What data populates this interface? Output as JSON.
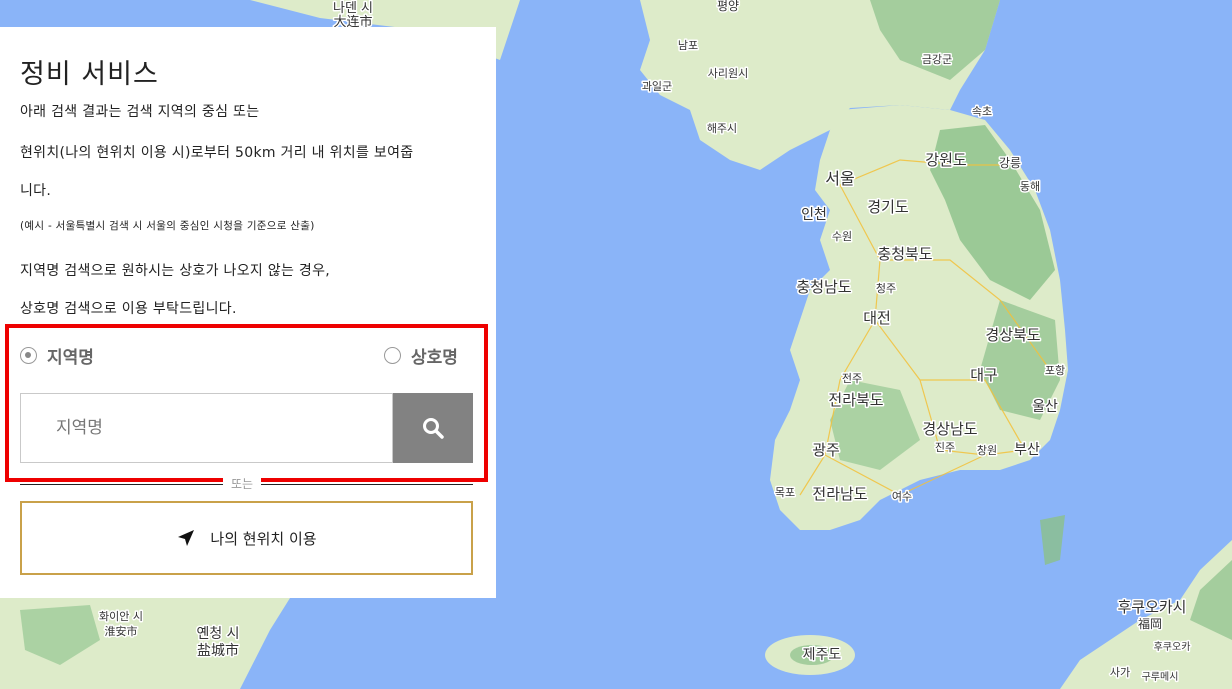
{
  "panel": {
    "title": "정비 서비스",
    "desc_line1": "아래 검색 결과는 검색 지역의 중심 또는",
    "desc_line2": "현위치(나의 현위치 이용 시)로부터 50km 거리 내 위치를 보여줍",
    "desc_line3": "니다.",
    "note": "(예시 - 서울특별시 검색 시 서울의 중심인 시청을 기준으로 산출)",
    "desc_line4": "지역명 검색으로 원하시는 상호가 나오지 않는 경우,",
    "desc_line5": "상호명 검색으로 이용 부탁드립니다."
  },
  "search_type": {
    "options": [
      {
        "label": "지역명",
        "selected": true
      },
      {
        "label": "상호명",
        "selected": false
      }
    ]
  },
  "search": {
    "placeholder": "지역명",
    "value": ""
  },
  "divider_text": "또는",
  "location_button": {
    "label": "나의 현위치 이용"
  },
  "map": {
    "labels": [
      {
        "text": "평양"
      },
      {
        "text": "남포"
      },
      {
        "text": "사리원시"
      },
      {
        "text": "과일군"
      },
      {
        "text": "해주시"
      },
      {
        "text": "금강군"
      },
      {
        "text": "속초"
      },
      {
        "text": "강원도"
      },
      {
        "text": "강릉"
      },
      {
        "text": "동해"
      },
      {
        "text": "서울"
      },
      {
        "text": "인천"
      },
      {
        "text": "수원"
      },
      {
        "text": "경기도"
      },
      {
        "text": "충청북도"
      },
      {
        "text": "충청남도"
      },
      {
        "text": "청주"
      },
      {
        "text": "대전"
      },
      {
        "text": "경상북도"
      },
      {
        "text": "포항"
      },
      {
        "text": "전주"
      },
      {
        "text": "전라북도"
      },
      {
        "text": "대구"
      },
      {
        "text": "울산"
      },
      {
        "text": "경상남도"
      },
      {
        "text": "광주"
      },
      {
        "text": "진주"
      },
      {
        "text": "창원"
      },
      {
        "text": "부산"
      },
      {
        "text": "목포"
      },
      {
        "text": "전라남도"
      },
      {
        "text": "여수"
      },
      {
        "text": "제주도"
      },
      {
        "text": "후쿠오카시"
      },
      {
        "text": "福岡"
      },
      {
        "text": "후쿠오카"
      },
      {
        "text": "사가"
      },
      {
        "text": "구루메시"
      },
      {
        "text": "화이안 시"
      },
      {
        "text": "淮安市"
      },
      {
        "text": "옌청 시"
      },
      {
        "text": "盐城市"
      },
      {
        "text": "나덴 시"
      },
      {
        "text": "大连市"
      }
    ]
  },
  "colors": {
    "water": "#8ab4f8",
    "land": "#ddebc9",
    "forest": "#8bc18a",
    "accent_border": "#c9a14a",
    "highlight": "#ee0000",
    "search_button": "#828282"
  }
}
